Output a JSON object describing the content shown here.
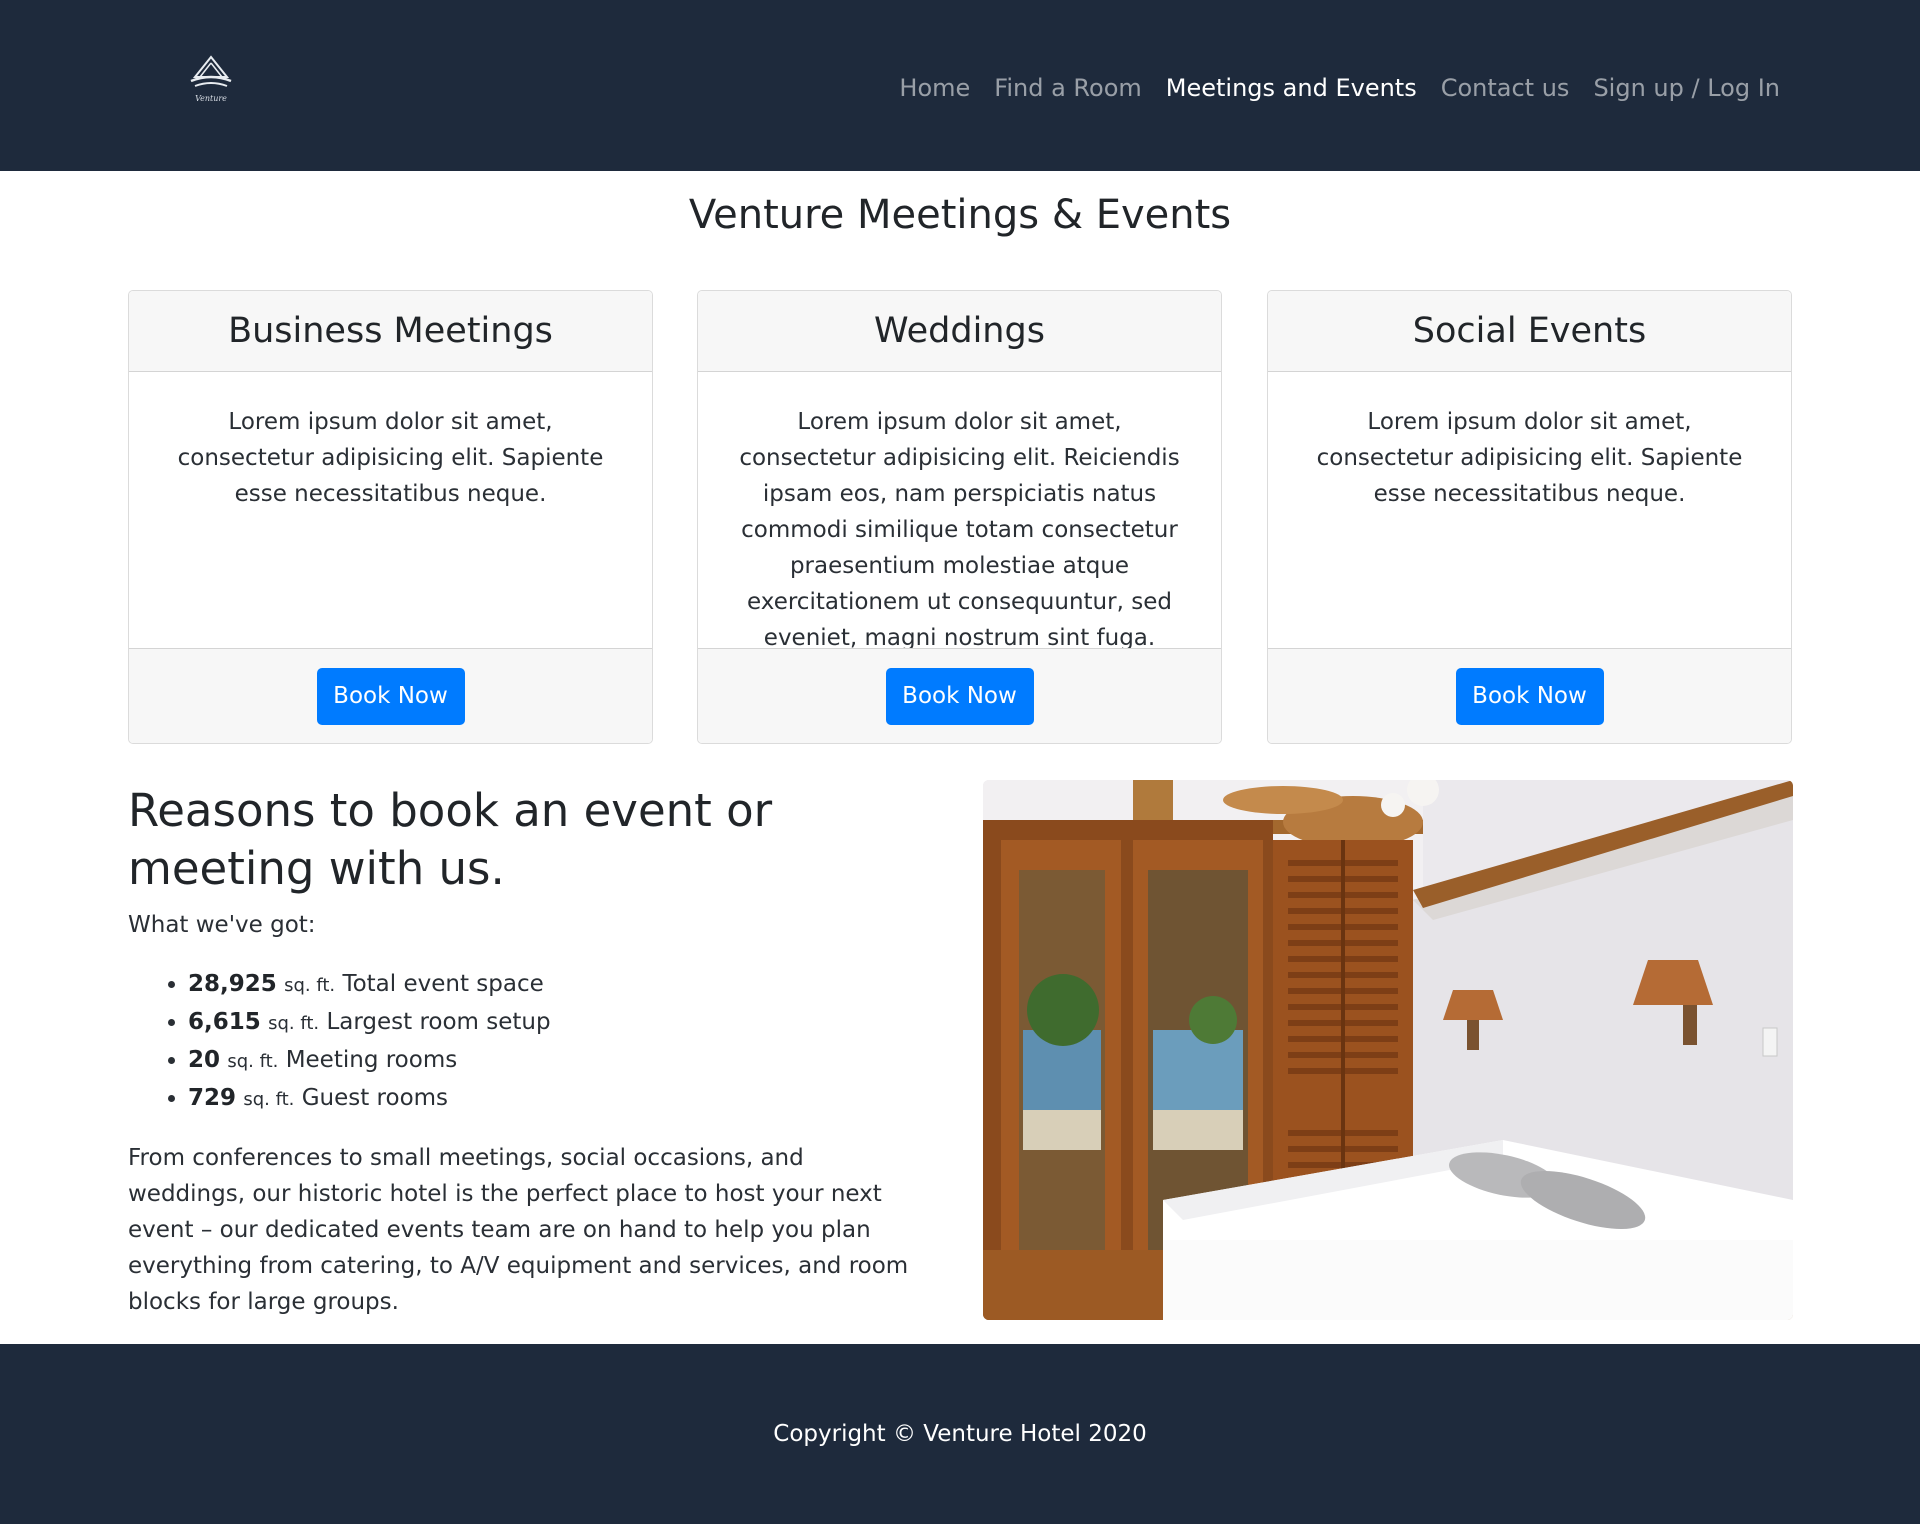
{
  "header": {
    "logo_text": "Venture",
    "nav": [
      {
        "label": "Home",
        "active": false
      },
      {
        "label": "Find a Room",
        "active": false
      },
      {
        "label": "Meetings and Events",
        "active": true
      },
      {
        "label": "Contact us",
        "active": false
      },
      {
        "label": "Sign up / Log In",
        "active": false
      }
    ]
  },
  "page": {
    "title": "Venture Meetings & Events"
  },
  "cards": [
    {
      "title": "Business Meetings",
      "body": "Lorem ipsum dolor sit amet, consectetur adipisicing elit. Sapiente esse necessitatibus neque.",
      "button": "Book Now"
    },
    {
      "title": "Weddings",
      "body": "Lorem ipsum dolor sit amet, consectetur adipisicing elit. Reiciendis ipsam eos, nam perspiciatis natus commodi similique totam consectetur praesentium molestiae atque exercitationem ut consequuntur, sed eveniet, magni nostrum sint fuga.",
      "button": "Book Now"
    },
    {
      "title": "Social Events",
      "body": "Lorem ipsum dolor sit amet, consectetur adipisicing elit. Sapiente esse necessitatibus neque.",
      "button": "Book Now"
    }
  ],
  "reasons": {
    "heading": "Reasons to book an event or meeting with us.",
    "intro": "What we've got:",
    "stats": [
      {
        "value": "28,925",
        "unit": "sq. ft.",
        "label": "Total event space"
      },
      {
        "value": "6,615",
        "unit": "sq. ft.",
        "label": "Largest room setup"
      },
      {
        "value": "20",
        "unit": "sq. ft.",
        "label": "Meeting rooms"
      },
      {
        "value": "729",
        "unit": "sq. ft.",
        "label": "Guest rooms"
      }
    ],
    "description": "From conferences to small meetings, social occasions, and weddings, our historic hotel is the perfect place to host your next event – our dedicated events team are on hand to help you plan everything from catering, to A/V equipment and services, and room blocks for large groups."
  },
  "footer": {
    "copyright": "Copyright © Venture Hotel 2020"
  },
  "colors": {
    "navbar_bg": "#1e2a3c",
    "primary_button": "#007bff",
    "card_header_bg": "#f7f7f7"
  }
}
